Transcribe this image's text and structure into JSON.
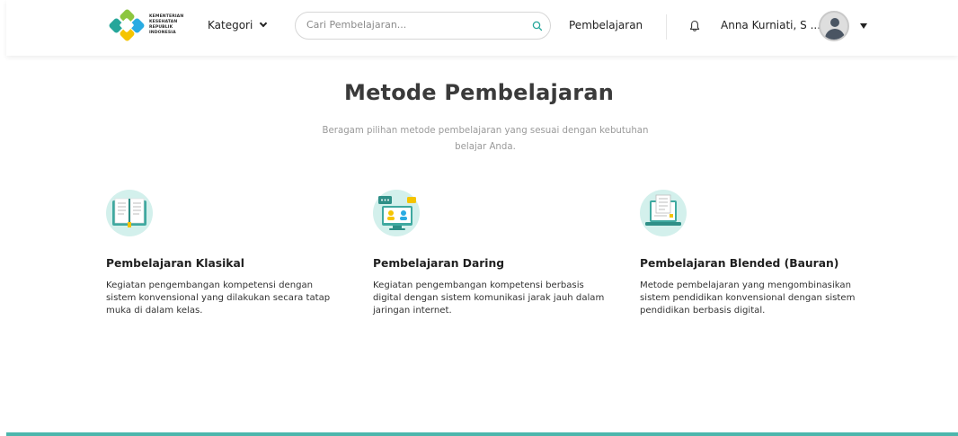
{
  "header": {
    "logo_lines": [
      "KEMENTERIAN",
      "KESEHATAN",
      "REPUBLIK",
      "INDONESIA"
    ],
    "kategori_label": "Kategori",
    "search_placeholder": "Cari Pembelajaran...",
    "nav_pembelajaran": "Pembelajaran",
    "user_name": "Anna Kurniati, S ..."
  },
  "main": {
    "title": "Metode Pembelajaran",
    "subtitle": "Beragam pilihan metode pembelajaran yang sesuai dengan kebutuhan belajar Anda.",
    "methods": [
      {
        "icon": "book-icon",
        "title": "Pembelajaran Klasikal",
        "description": "Kegiatan pengembangan kompetensi dengan sistem konvensional yang dilakukan secara tatap muka di dalam kelas."
      },
      {
        "icon": "video-conference-icon",
        "title": "Pembelajaran Daring",
        "description": "Kegiatan pengembangan kompetensi berbasis digital dengan sistem komunikasi jarak jauh dalam jaringan internet."
      },
      {
        "icon": "laptop-document-icon",
        "title": "Pembelajaran Blended (Bauran)",
        "description": "Metode pembelajaran yang mengombinasikan sistem pendidikan konvensional dengan sistem pendidikan berbasis digital."
      }
    ]
  },
  "colors": {
    "accent": "#4db6ac",
    "icon_bg": "#d3f0ec",
    "logo_green": "#8cc63f",
    "logo_teal": "#26a69a",
    "logo_blue": "#29abe2",
    "logo_yellow": "#f5c400"
  }
}
